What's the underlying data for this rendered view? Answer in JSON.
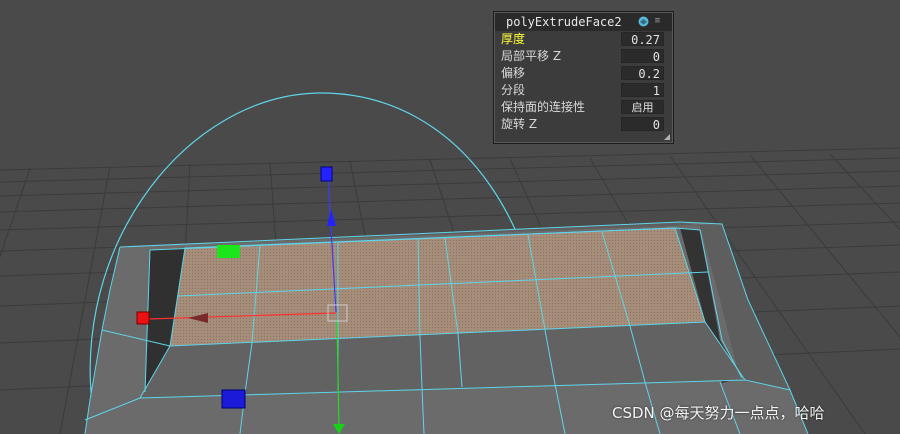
{
  "channel_box": {
    "node_name": "polyExtrudeFace2",
    "node_icon": "poly-node-icon",
    "menu_icon": "options-menu-icon",
    "attributes": [
      {
        "label": "厚度",
        "value": "0.27",
        "active": true
      },
      {
        "label": "局部平移 Z",
        "value": "0",
        "active": false
      },
      {
        "label": "偏移",
        "value": "0.2",
        "active": false
      },
      {
        "label": "分段",
        "value": "1",
        "active": false
      },
      {
        "label": "保持面的连接性",
        "value": "启用",
        "active": false
      },
      {
        "label": "旋转 Z",
        "value": "0",
        "active": false
      }
    ]
  },
  "viewport": {
    "background_color": "#4a4a4a",
    "grid_color": "#3a3a3a",
    "wireframe_color": "#5fd4ea",
    "selected_face_color": "#a8907c",
    "manipulator": {
      "x_axis_color": "#ff1a1a",
      "y_axis_color": "#1aff1a",
      "z_axis_color": "#1a1aff",
      "scale_handle_color": "#1ae61a"
    }
  },
  "watermark": "CSDN @每天努力一点点，哈哈"
}
